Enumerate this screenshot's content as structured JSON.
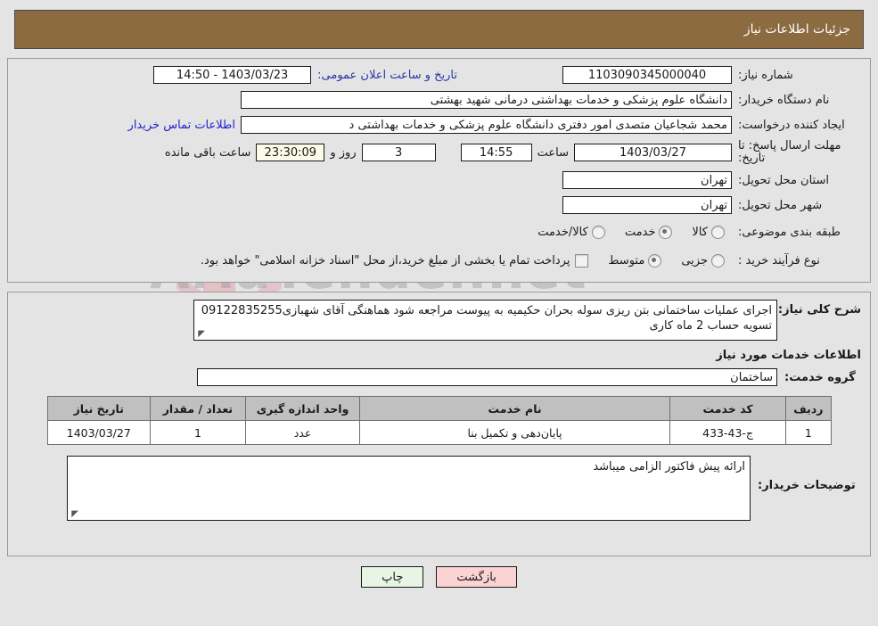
{
  "header": {
    "title": "جزئیات اطلاعات نیاز"
  },
  "fields": {
    "need_number_label": "شماره نیاز:",
    "need_number_value": "1103090345000040",
    "announce_label": "تاریخ و ساعت اعلان عمومی:",
    "announce_value": "1403/03/23 - 14:50",
    "buyer_org_label": "نام دستگاه خریدار:",
    "buyer_org_value": "دانشگاه علوم پزشکی و خدمات بهداشتی درمانی شهید بهشتی",
    "creator_label": "ایجاد کننده درخواست:",
    "creator_value": "محمد شجاعیان متصدی امور دفتری دانشگاه علوم پزشکی و خدمات بهداشتی د",
    "contact_link": "اطلاعات تماس خریدار",
    "deadline_label": "مهلت ارسال پاسخ: تا تاریخ:",
    "deadline_date": "1403/03/27",
    "hour_label": "ساعت",
    "deadline_hour": "14:55",
    "days_remaining": "3",
    "days_label": "روز و",
    "countdown": "23:30:09",
    "countdown_label": "ساعت باقی مانده",
    "province_label": "استان محل تحویل:",
    "province_value": "تهران",
    "city_label": "شهر محل تحویل:",
    "city_value": "تهران",
    "category_label": "طبقه بندی موضوعی:",
    "purchase_label": "نوع فرآیند خرید :",
    "treasury_note": "پرداخت تمام یا بخشی از مبلغ خرید،از محل \"اسناد خزانه اسلامی\" خواهد بود."
  },
  "category_options": [
    {
      "label": "کالا",
      "selected": false
    },
    {
      "label": "خدمت",
      "selected": true
    },
    {
      "label": "کالا/خدمت",
      "selected": false
    }
  ],
  "purchase_options": [
    {
      "label": "جزیی",
      "selected": false
    },
    {
      "label": "متوسط",
      "selected": true
    }
  ],
  "description": {
    "label": "شرح کلی نیاز:",
    "value": "اجرای عملیات ساختمانی بتن ریزی سوله بحران حکیمیه به پیوست مراجعه شود هماهنگی آقای شهبازی09122835255 تسویه حساب 2 ماه کاری"
  },
  "services_section": {
    "title": "اطلاعات خدمات مورد نیاز",
    "group_label": "گروه خدمت:",
    "group_value": "ساختمان"
  },
  "table": {
    "headers": [
      "ردیف",
      "کد خدمت",
      "نام خدمت",
      "واحد اندازه گیری",
      "تعداد / مقدار",
      "تاریخ نیاز"
    ],
    "rows": [
      [
        "1",
        "ج-43-433",
        "پایان‌دهی و تکمیل بنا",
        "عدد",
        "1",
        "1403/03/27"
      ]
    ]
  },
  "buyer_notes": {
    "label": "توضیحات خریدار:",
    "value": "ارائه پیش فاکتور الزامی میباشد"
  },
  "buttons": {
    "print": "چاپ",
    "back": "بازگشت"
  },
  "watermark": {
    "text": "AriaTender.net"
  },
  "colors": {
    "header_bar": "#8c6b41",
    "page_bg": "#e4e4e4",
    "link": "#2222cc",
    "print_btn": "#e8f5e4",
    "back_btn": "#fbd3d3",
    "countdown_bg": "#fbfbe8",
    "table_header": "#c0c0c0"
  }
}
